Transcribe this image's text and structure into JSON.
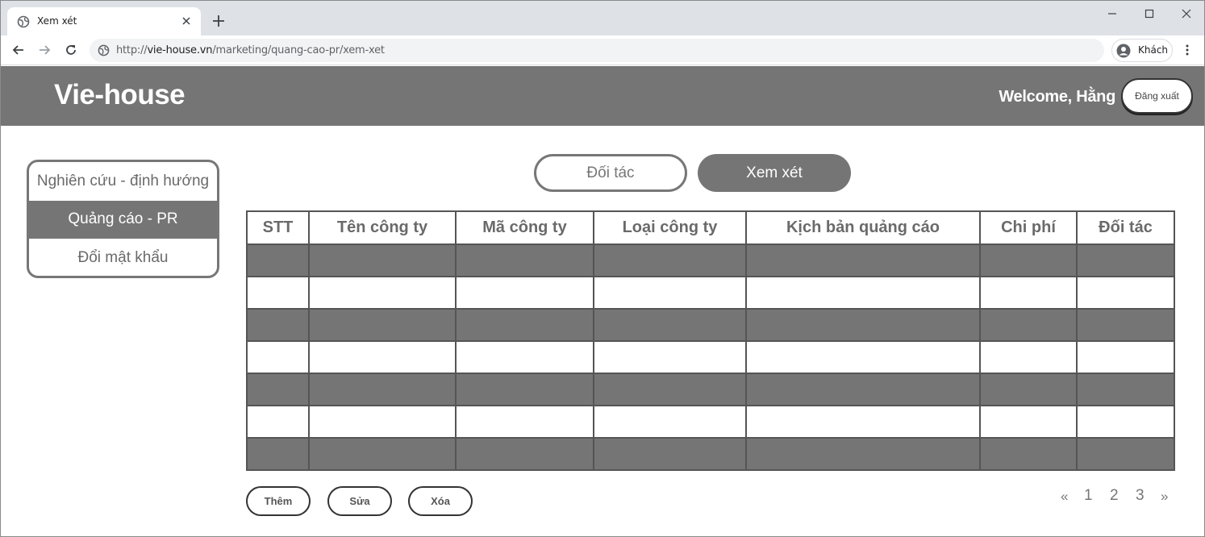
{
  "browser": {
    "tab_title": "Xem xét",
    "url_scheme": "http://",
    "url_host": "vie-house.vn",
    "url_path": "/marketing/quang-cao-pr/xem-xet",
    "profile_label": "Khách",
    "icons": [
      "globe-icon",
      "close-icon",
      "plus-icon",
      "minimize-icon",
      "maximize-icon",
      "back-icon",
      "forward-icon",
      "reload-icon",
      "avatar-icon",
      "kebab-menu-icon"
    ]
  },
  "header": {
    "logo": "Vie-house",
    "welcome": "Welcome, Hằng",
    "logout_label": "Đăng xuất"
  },
  "sidebar": {
    "items": [
      {
        "label": "Nghiên cứu - định hướng",
        "active": false
      },
      {
        "label": "Quảng cáo - PR",
        "active": true
      },
      {
        "label": "Đổi mật khẩu",
        "active": false
      }
    ]
  },
  "segment": {
    "left_label": "Đối tác",
    "right_label": "Xem xét",
    "selected": "Xem xét"
  },
  "table": {
    "columns": [
      "STT",
      "Tên công ty",
      "Mã công ty",
      "Loại công ty",
      "Kịch bản quảng cáo",
      "Chi phí",
      "Đối tác"
    ],
    "rows": [
      [
        "",
        "",
        "",
        "",
        "",
        "",
        ""
      ],
      [
        "",
        "",
        "",
        "",
        "",
        "",
        ""
      ],
      [
        "",
        "",
        "",
        "",
        "",
        "",
        ""
      ],
      [
        "",
        "",
        "",
        "",
        "",
        "",
        ""
      ],
      [
        "",
        "",
        "",
        "",
        "",
        "",
        ""
      ],
      [
        "",
        "",
        "",
        "",
        "",
        "",
        ""
      ],
      [
        "",
        "",
        "",
        "",
        "",
        "",
        ""
      ]
    ]
  },
  "actions": {
    "add_label": "Thêm",
    "edit_label": "Sửa",
    "delete_label": "Xóa"
  },
  "pagination": {
    "prev": "«",
    "pages": [
      "1",
      "2",
      "3"
    ],
    "next": "»"
  },
  "colors": {
    "header_bg": "#757575",
    "accent_gray": "#757575",
    "text_gray": "#6a6a6a"
  }
}
